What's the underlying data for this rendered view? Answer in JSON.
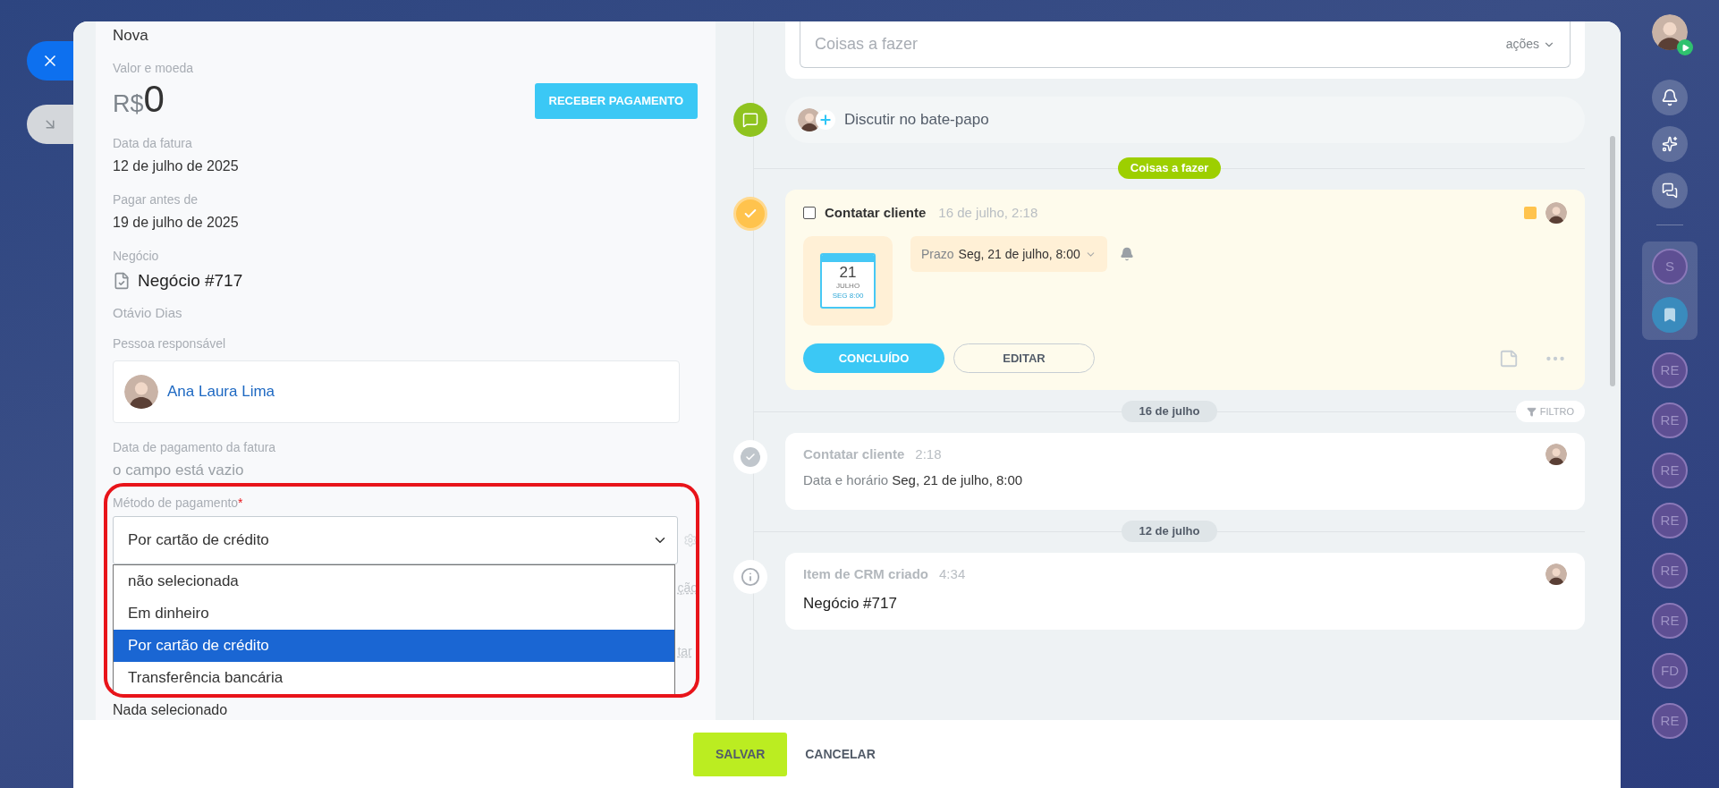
{
  "invoice": {
    "status": "Nova",
    "amount_label": "Valor e moeda",
    "currency": "R$",
    "amount": "0",
    "pay_button": "RECEBER PAGAMENTO",
    "fields": [
      {
        "kind": "text",
        "label": "Data da fatura",
        "value": "12 de julho de 2025"
      },
      {
        "kind": "text",
        "label": "Pagar antes de",
        "value": "19 de julho de 2025"
      },
      {
        "kind": "deal",
        "label": "Negócio",
        "value": "Negócio #717",
        "note": "Otávio Dias"
      },
      {
        "kind": "person",
        "label": "Pessoa responsável",
        "value": "Ana Laura Lima"
      },
      {
        "kind": "empty",
        "label": "Data de pagamento da fatura",
        "value": "o campo está vazio"
      }
    ],
    "payment_method": {
      "label": "Método de pagamento",
      "required": "*",
      "value": "Por cartão de crédito",
      "expanded": true,
      "options": [
        {
          "label": "não selecionada",
          "selected": false
        },
        {
          "label": "Em dinheiro",
          "selected": false
        },
        {
          "label": "Por cartão de crédito",
          "selected": true
        },
        {
          "label": "Transferência bancária",
          "selected": false
        }
      ]
    },
    "cut_fragments": [
      "ção",
      "tar"
    ],
    "next_value": "Nada selecionado"
  },
  "timeline": {
    "composer_placeholder": "Coisas a fazer",
    "composer_menu": "ações",
    "chat_label": "Discutir no bate-papo",
    "items": [
      {
        "kind": "todo-divider",
        "label": "Coisas a fazer"
      },
      {
        "kind": "task",
        "title": "Contatar cliente",
        "time": "16 de julho, 2:18",
        "checked": false,
        "calendar": {
          "day": "21",
          "month": "JULHO",
          "weekday_time": "SEG 8:00"
        },
        "deadline_label": "Prazo",
        "deadline": "Seg, 21 de julho, 8:00",
        "done_button": "CONCLUÍDO",
        "edit_button": "EDITAR"
      },
      {
        "kind": "date-divider",
        "label": "16 de julho",
        "filter": "FILTRO"
      },
      {
        "kind": "done",
        "title": "Contatar cliente",
        "time": "2:18",
        "detail_label": "Data e horário",
        "detail": "Seg, 21 de julho, 8:00"
      },
      {
        "kind": "date-divider",
        "label": "12 de julho"
      },
      {
        "kind": "created",
        "title": "Item de CRM criado",
        "time": "4:34",
        "body": "Negócio #717"
      }
    ]
  },
  "footer": {
    "save": "SALVAR",
    "cancel": "CANCELAR"
  },
  "sidebar": {
    "pinned": [
      {
        "kind": "initials",
        "text": "S"
      },
      {
        "kind": "bookmark"
      }
    ],
    "chats": [
      {
        "text": "RE"
      },
      {
        "text": "RE"
      },
      {
        "text": "RE"
      },
      {
        "text": "RE"
      },
      {
        "text": "RE"
      },
      {
        "text": "RE"
      },
      {
        "text": "FD"
      },
      {
        "text": "RE"
      }
    ]
  }
}
